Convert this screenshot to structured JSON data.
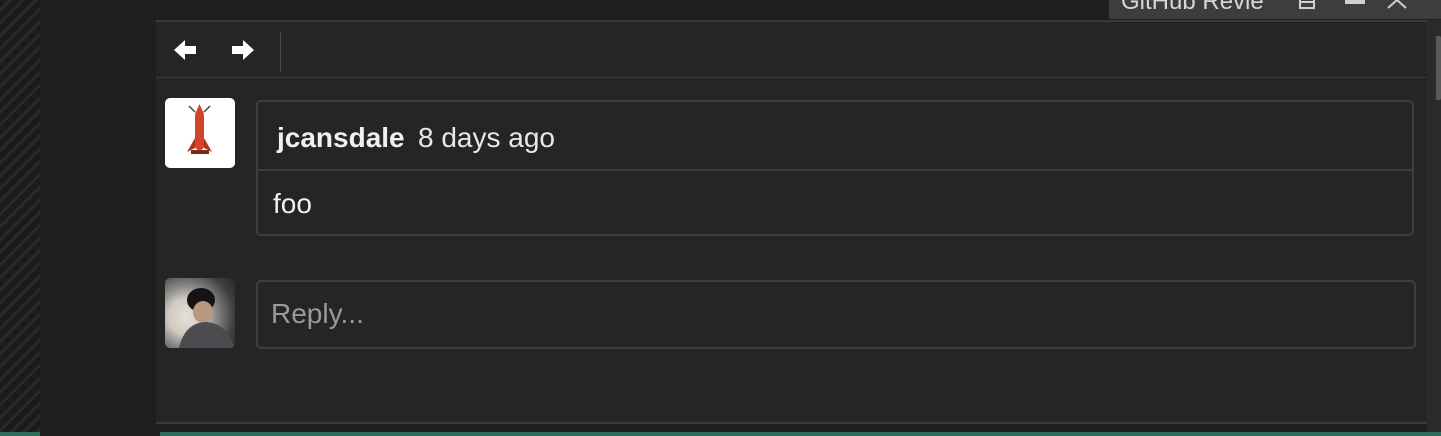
{
  "tool_window": {
    "title": "GitHub Revie",
    "icons": [
      "pin-icon",
      "minimize-icon",
      "close-icon"
    ]
  },
  "toolbar": {
    "back_icon": "arrow-left-icon",
    "forward_icon": "arrow-right-icon"
  },
  "comment": {
    "author": "jcansdale",
    "timestamp": "8 days ago",
    "body": "foo",
    "avatar_icon": "avatar-rocket"
  },
  "reply": {
    "placeholder": "Reply...",
    "avatar_icon": "avatar-user-photo"
  },
  "colors": {
    "panel_bg": "#252526",
    "border": "#3e3e42",
    "accent_bottom": "#2d6b5b"
  }
}
